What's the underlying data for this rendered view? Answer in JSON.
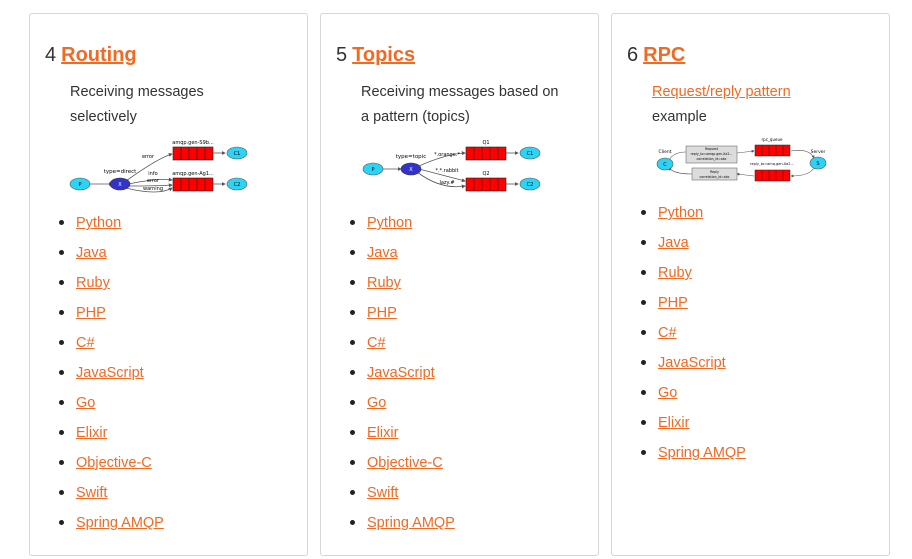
{
  "cards": [
    {
      "number": "4",
      "title": "Routing",
      "desc_line1": "Receiving messages",
      "desc_line2": "selectively",
      "diagram": {
        "producer": "P",
        "exchange": "X",
        "type_label": "type=direct",
        "binding_error": "error",
        "binding_info": "info",
        "binding_error2": "error",
        "binding_warning": "warning",
        "queue1": "amqp.gen-S9b...",
        "queue2": "amqp.gen-Ag1...",
        "consumer1": "C1",
        "consumer2": "C2"
      },
      "languages": [
        "Python",
        "Java",
        "Ruby",
        "PHP",
        "C#",
        "JavaScript",
        "Go",
        "Elixir",
        "Objective-C",
        "Swift",
        "Spring AMQP"
      ]
    },
    {
      "number": "5",
      "title": "Topics",
      "desc_line1": "Receiving messages based on",
      "desc_line2": "a pattern (topics)",
      "diagram": {
        "producer": "P",
        "exchange": "X",
        "type_label": "type=topic",
        "binding_orange": "*.orange.*",
        "binding_rabbit": "*.*.rabbit",
        "binding_lazy": "lazy.#",
        "queue1": "Q1",
        "queue2": "Q2",
        "consumer1": "C1",
        "consumer2": "C2"
      },
      "languages": [
        "Python",
        "Java",
        "Ruby",
        "PHP",
        "C#",
        "JavaScript",
        "Go",
        "Elixir",
        "Objective-C",
        "Swift",
        "Spring AMQP"
      ]
    },
    {
      "number": "6",
      "title": "RPC",
      "desc_link": "Request/reply pattern",
      "desc_line2": "example",
      "diagram": {
        "client": "C",
        "server": "S",
        "client_label": "Client",
        "server_label": "Server",
        "rpc_queue": "rpc_queue",
        "reply_queue": "reply_to=amq.gen-Xa2...",
        "request_line1": "Request",
        "request_line2": "reply_to=amqp.gen-Xa2...",
        "request_line3": "correlation_id=abc",
        "reply_line1": "Reply",
        "reply_line2": "correlation_id=abc"
      },
      "languages": [
        "Python",
        "Java",
        "Ruby",
        "PHP",
        "C#",
        "JavaScript",
        "Go",
        "Elixir",
        "Spring AMQP"
      ]
    }
  ],
  "colors": {
    "link": "#f26922",
    "queue": "#ff0000",
    "producer": "#2bd4f6",
    "exchange": "#3333cc"
  }
}
